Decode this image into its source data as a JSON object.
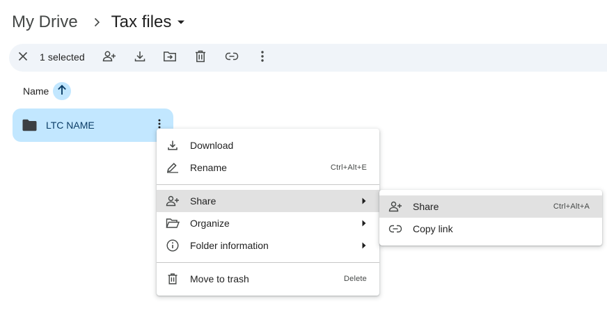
{
  "breadcrumb": {
    "root": "My Drive",
    "current": "Tax files"
  },
  "toolbar": {
    "selected_count": "1 selected",
    "icons": [
      "close-icon",
      "share-icon",
      "download-icon",
      "move-icon",
      "trash-icon",
      "link-icon",
      "more-vert-icon"
    ]
  },
  "sort": {
    "label": "Name",
    "direction": "ascending"
  },
  "folder": {
    "name": "LTC NAME"
  },
  "context_menu": {
    "download": {
      "label": "Download"
    },
    "rename": {
      "label": "Rename",
      "shortcut": "Ctrl+Alt+E"
    },
    "share": {
      "label": "Share"
    },
    "organize": {
      "label": "Organize"
    },
    "folder_info": {
      "label": "Folder information"
    },
    "trash": {
      "label": "Move to trash",
      "shortcut": "Delete"
    }
  },
  "share_submenu": {
    "share": {
      "label": "Share",
      "shortcut": "Ctrl+Alt+A"
    },
    "copy_link": {
      "label": "Copy link"
    }
  },
  "colors": {
    "selection_blue": "#c2e7ff",
    "toolbar_bg": "#f0f4f9",
    "hover_gray": "#e1e1e1",
    "folder_text": "#0b3d66"
  }
}
